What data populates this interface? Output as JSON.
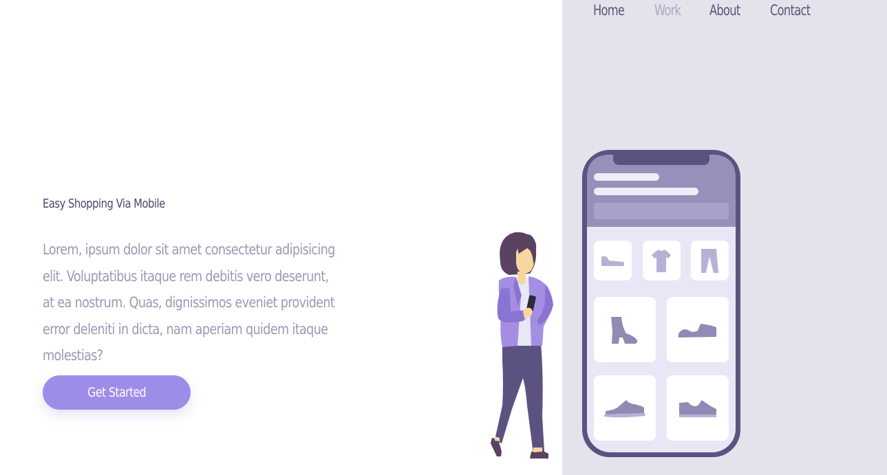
{
  "nav": {
    "items": [
      {
        "label": "Home",
        "active": false
      },
      {
        "label": "Work",
        "active": true
      },
      {
        "label": "About",
        "active": false
      },
      {
        "label": "Contact",
        "active": false
      }
    ]
  },
  "hero": {
    "title": "Easy Shopping Via Mobile",
    "text": "Lorem, ipsum dolor sit amet consectetur adipisicing elit. Voluptatibus itaque rem debitis vero deserunt, at ea nostrum. Quas, dignissimos eveniet provident error deleniti in dicta, nam aperiam quidem itaque molestias?",
    "cta_label": "Get Started"
  },
  "colors": {
    "accent": "#9e8de8",
    "panel": "#e4e3eb",
    "phone_frame": "#5c5282",
    "phone_header": "#9591bb",
    "product_icon": "#8f8bb4"
  },
  "illustration": {
    "products": [
      "shoe-icon",
      "tshirt-icon",
      "pants-icon",
      "boot-icon",
      "sneaker-icon",
      "sneaker-icon",
      "sneaker-icon"
    ]
  }
}
